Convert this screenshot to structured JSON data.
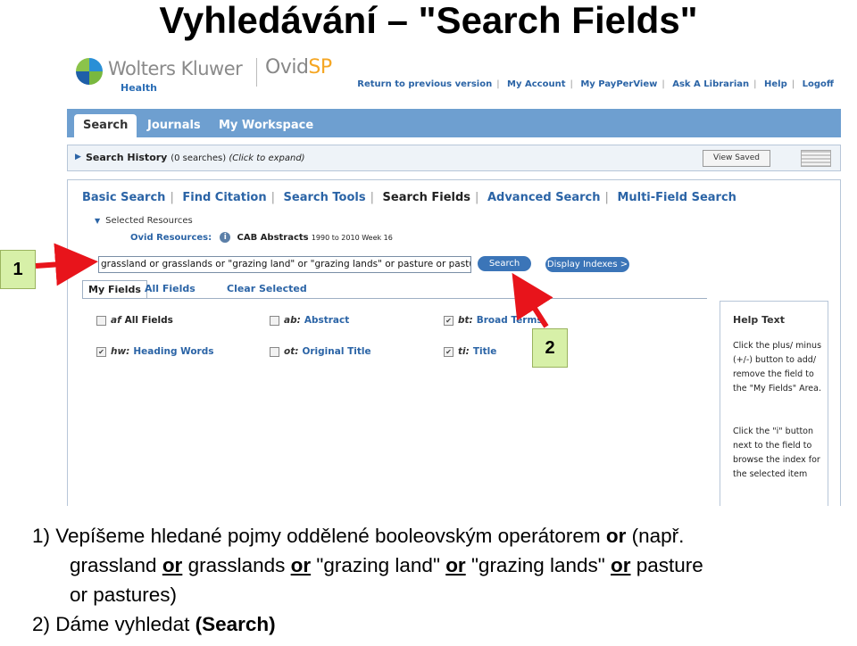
{
  "slide": {
    "title": "Vyhledávání – \"Search Fields\"",
    "marker_1": "1",
    "marker_2": "2",
    "caption": {
      "line1_pre": "1) Vepíšeme hledané pojmy oddělené booleovským operátorem ",
      "line1_or": "or",
      "line1_post": " (např.",
      "l2_a": "grassland ",
      "op": "or",
      "l2_b": " grasslands ",
      "l2_c": " \"grazing land\" ",
      "l2_d": " \"grazing lands\" ",
      "l2_e": " pasture",
      "l3": "or pastures)",
      "line4_pre": "2) Dáme vyhledat ",
      "line4_bold": "(Search)"
    }
  },
  "header": {
    "brand": "Wolters Kluwer",
    "brand_sub": "Health",
    "product_a": "Ovid",
    "product_b": "SP",
    "links": [
      "Return to previous version",
      "My Account",
      "My PayPerView",
      "Ask A Librarian",
      "Help",
      "Logoff"
    ]
  },
  "tabs": [
    "Search",
    "Journals",
    "My Workspace"
  ],
  "history": {
    "label": "Search History",
    "count": "(0 searches)",
    "hint": "(Click to expand)",
    "view_saved": "View Saved"
  },
  "search_modes": [
    "Basic Search",
    "Find Citation",
    "Search Tools",
    "Search Fields",
    "Advanced Search",
    "Multi-Field Search"
  ],
  "resources": {
    "toggle": "Selected Resources",
    "label": "Ovid Resources:",
    "db": "CAB Abstracts",
    "years": "1990 to 2010 Week 16"
  },
  "search": {
    "query": "grassland or grasslands or \"grazing land\" or \"grazing lands\" or pasture or pastu",
    "search_btn": "Search",
    "display_btn": "Display Indexes >"
  },
  "field_tabs": [
    "My Fields",
    "All Fields",
    "Clear Selected"
  ],
  "fields": [
    {
      "code": "af",
      "name": "All Fields",
      "checked": false
    },
    {
      "code": "ab:",
      "name": "Abstract",
      "checked": false
    },
    {
      "code": "bt:",
      "name": "Broad Terms",
      "checked": true
    },
    {
      "code": "hw:",
      "name": "Heading Words",
      "checked": true
    },
    {
      "code": "ot:",
      "name": "Original Title",
      "checked": false
    },
    {
      "code": "ti:",
      "name": "Title",
      "checked": true
    }
  ],
  "help": {
    "title": "Help Text",
    "p1": "Click the plus/ minus (+/-) button to add/ remove the field to the \"My Fields\" Area.",
    "p2": "Click the \"i\" button next to the field to browse the index for the selected item"
  },
  "colors": {
    "tab_bar": "#6e9fd0",
    "link": "#2b64a6",
    "button": "#3b75b8",
    "arrow": "#e8141b",
    "marker_bg": "#d7f0a8"
  }
}
